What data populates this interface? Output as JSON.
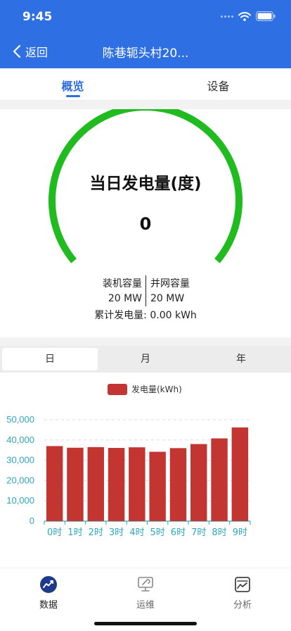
{
  "status_bar": {
    "time": "9:45"
  },
  "header": {
    "back_label": "返回",
    "title": "陈巷轭头村20..."
  },
  "tabs": [
    {
      "label": "概览",
      "active": true
    },
    {
      "label": "设备",
      "active": false
    }
  ],
  "overview": {
    "gauge_title": "当日发电量(度)",
    "gauge_value": "0",
    "gauge_color": "#1fbb1f",
    "installed_label": "装机容量",
    "installed_value": "20 MW",
    "grid_label": "并网容量",
    "grid_value": "20 MW",
    "total_line": "累计发电量:  0.00 kWh"
  },
  "period_tabs": [
    {
      "label": "日",
      "active": true
    },
    {
      "label": "月",
      "active": false
    },
    {
      "label": "年",
      "active": false
    }
  ],
  "chart_data": {
    "type": "bar",
    "title": "",
    "xlabel": "",
    "ylabel": "",
    "legend": {
      "name": "发电量(kWh)",
      "placement": "top-center"
    },
    "categories": [
      "0时",
      "1时",
      "2时",
      "3时",
      "4时",
      "5时",
      "6时",
      "7时",
      "8时",
      "9时"
    ],
    "series": [
      {
        "name": "发电量(kWh)",
        "color": "#c23531",
        "values": [
          37000,
          36200,
          36500,
          36100,
          36400,
          34200,
          36000,
          38000,
          40800,
          46200
        ]
      }
    ],
    "ylim": [
      0,
      50000
    ],
    "yticks": [
      "0",
      "10,000",
      "20,000",
      "30,000",
      "40,000",
      "50,000"
    ],
    "grid": true,
    "axis_color": "#2ea7bf"
  },
  "bottom_nav": [
    {
      "label": "数据",
      "icon": "chart-trend-icon",
      "active": true
    },
    {
      "label": "运维",
      "icon": "monitor-wrench-icon",
      "active": false
    },
    {
      "label": "分析",
      "icon": "analysis-icon",
      "active": false
    }
  ]
}
